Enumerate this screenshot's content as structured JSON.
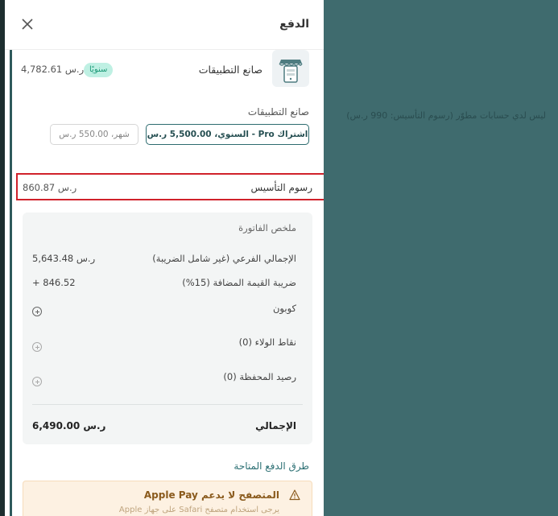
{
  "header": {
    "title": "الدفع"
  },
  "product": {
    "name": "صانع التطبيقات",
    "badge": "سنويًا",
    "price": "4,782.61 ر.س"
  },
  "plan_section": {
    "label": "صانع التطبيقات",
    "selected_plan": "اشتراك Pro - السنوي، 5,500.00 ر.س",
    "other_plan": "شهر، 550.00 ر.س"
  },
  "setup_fee": {
    "label": "رسوم التأسيس",
    "value": "860.87 ر.س"
  },
  "invoice": {
    "title": "ملخص الفاتورة",
    "subtotal_label": "الإجمالي الفرعي (غير شامل الضريبة)",
    "subtotal_value": "5,643.48 ر.س",
    "vat_label": "ضريبة القيمة المضافة (15%)",
    "vat_value": "+ 846.52",
    "coupon_label": "كوبون",
    "loyalty_label": "نقاط الولاء (0)",
    "wallet_label": "رصيد المحفظة (0)",
    "total_label": "الإجمالي",
    "total_value": "6,490.00 ر.س"
  },
  "payment_methods": {
    "label": "طرق الدفع المتاحة",
    "warning": "المتصفح لا يدعم Apple Pay",
    "warning_sub": "يرجى استخدام متصفح Safari على جهاز Apple"
  },
  "background": {
    "text": "ليس لدي حسابات مطوّر (رسوم التأسيس: 990 ر.س)"
  },
  "colors": {
    "overlay": "#3f6b6e",
    "accent": "#2d6b6f",
    "badge_bg": "#bff0e3",
    "badge_text": "#1e9a79",
    "highlight_border": "#d0222b",
    "warning_bg": "#fdf1e2"
  }
}
